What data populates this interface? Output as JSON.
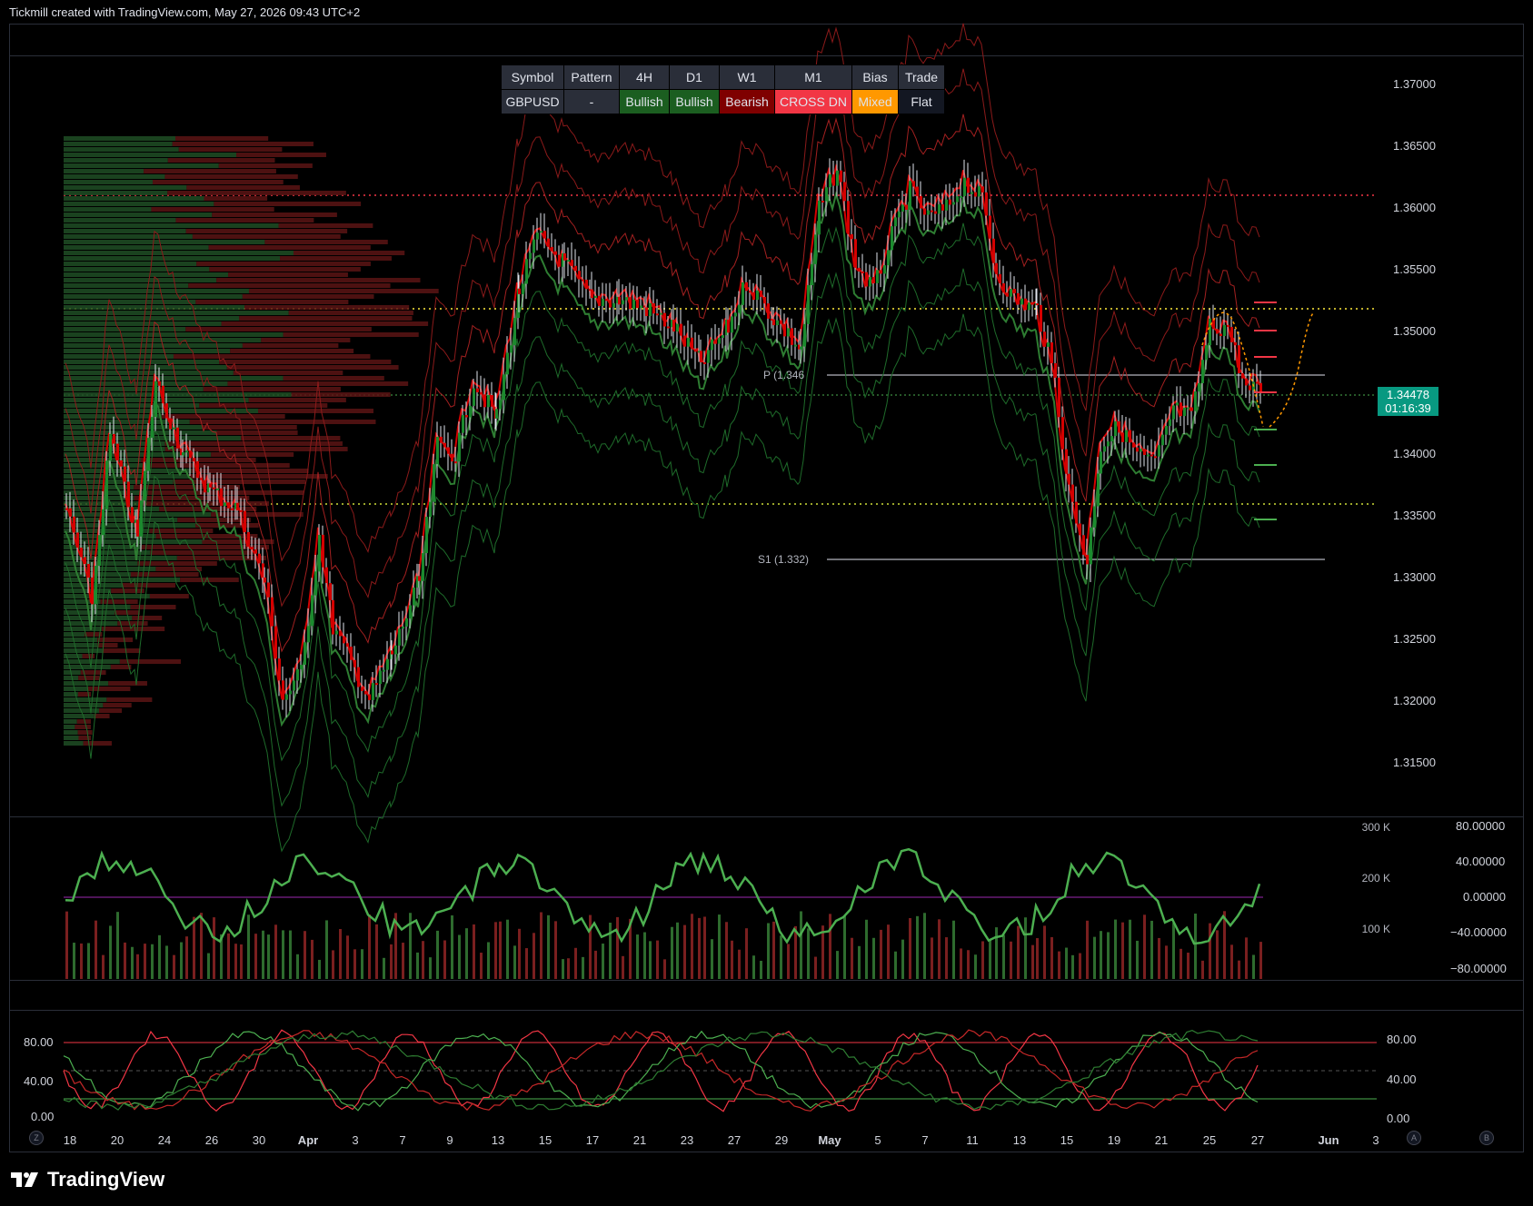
{
  "header": {
    "title": "Tickmill created with TradingView.com, May 27, 2026 09:43 UTC+2"
  },
  "table": {
    "headers": [
      "Symbol",
      "Pattern",
      "4H",
      "D1",
      "W1",
      "M1",
      "Bias",
      "Trade"
    ],
    "values": [
      "GBPUSD",
      "-",
      "Bullish",
      "Bullish",
      "Bearish",
      "CROSS DN",
      "Mixed",
      "Flat"
    ],
    "cell_colors": [
      "#2a2e39",
      "#2a2e39",
      "#1b5e20",
      "#1b5e20",
      "#7f0000",
      "#f23645",
      "#ff9800",
      "#131722"
    ]
  },
  "price_axis": [
    "1.37000",
    "1.36500",
    "1.36000",
    "1.35500",
    "1.35000",
    "1.34500",
    "1.34000",
    "1.33500",
    "1.33000",
    "1.32500",
    "1.32000",
    "1.31500"
  ],
  "last_price": {
    "price": "1.34478",
    "countdown": "01:16:39",
    "color": "#089981"
  },
  "pivots": {
    "p": "P (1.346",
    "s1": "S1 (1.332)"
  },
  "volume_axis": [
    "300 K",
    "200 K",
    "100 K"
  ],
  "rsi_axis": [
    "80.00000",
    "40.00000",
    "0.00000",
    "−40.00000",
    "−80.00000"
  ],
  "stoch_axis_left": [
    "80.00",
    "40.00",
    "0.00"
  ],
  "stoch_axis_right": [
    "80.00",
    "40.00",
    "0.00"
  ],
  "date_axis": [
    "18",
    "20",
    "24",
    "26",
    "30",
    "Apr",
    "3",
    "7",
    "9",
    "13",
    "15",
    "17",
    "21",
    "23",
    "27",
    "29",
    "May",
    "5",
    "7",
    "11",
    "13",
    "15",
    "19",
    "21",
    "25",
    "27",
    "Jun",
    "3"
  ],
  "corner_buttons": {
    "left": "Z",
    "a": "A",
    "b": "B"
  },
  "logo": {
    "text": "TradingView"
  },
  "colors": {
    "bull": "#4caf50",
    "bear": "#f23645",
    "candle_bull": "#1b8a2e",
    "candle_bear": "#d50000"
  }
}
